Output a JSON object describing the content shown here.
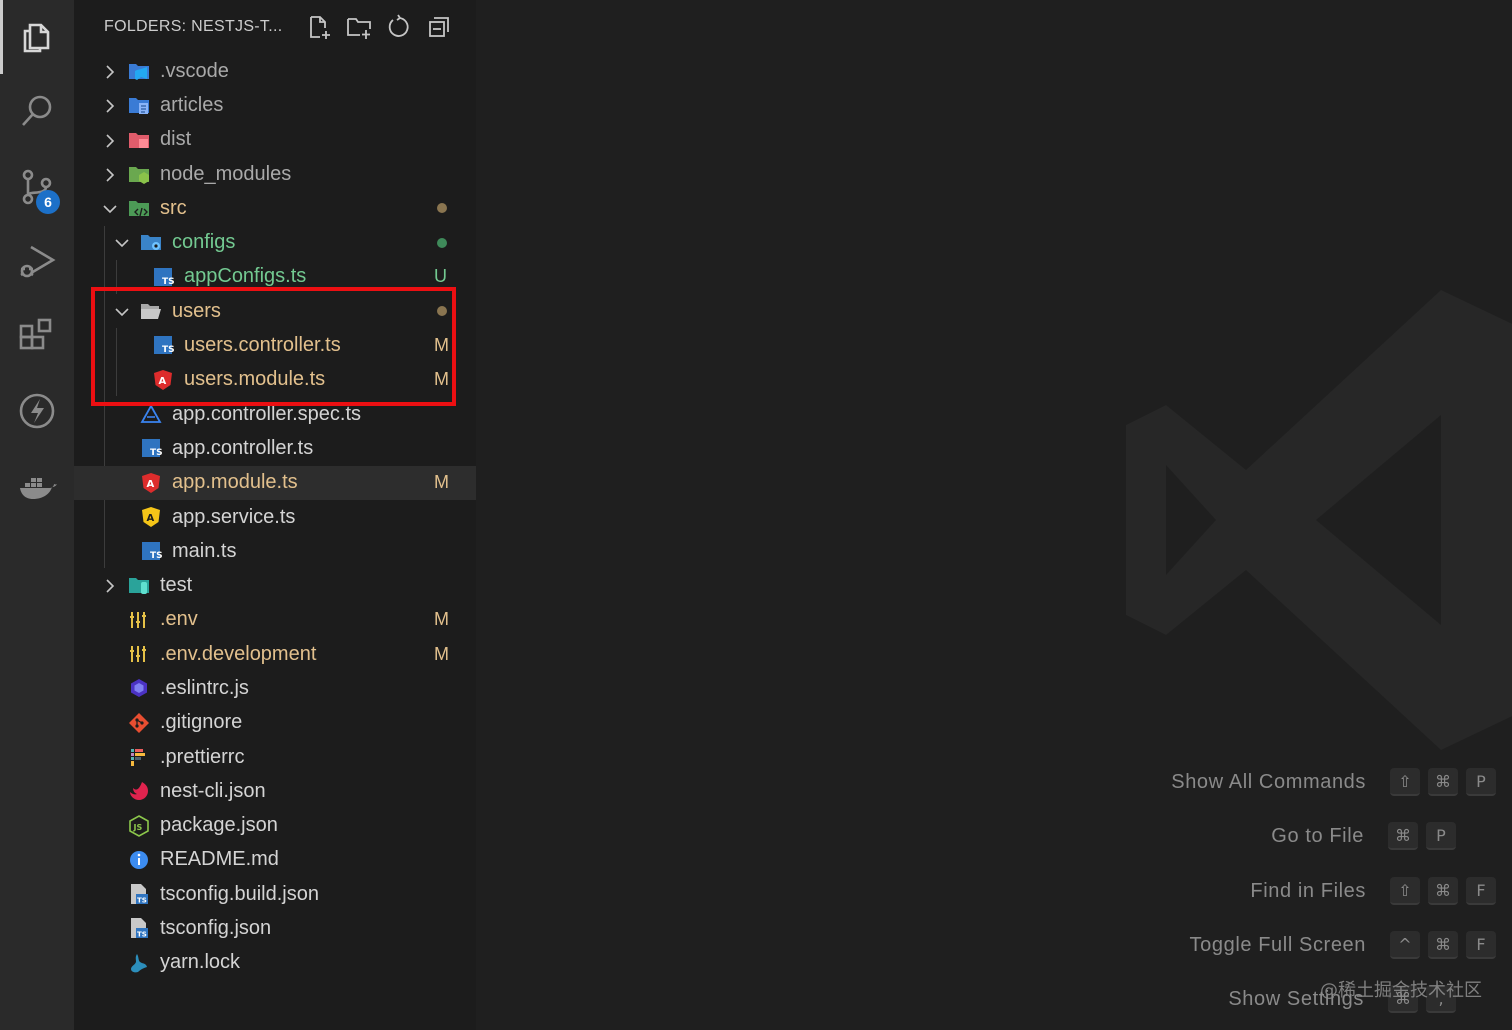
{
  "explorer": {
    "title": "FOLDERS: NESTJS-T...",
    "actions": [
      "new-file-icon",
      "new-folder-icon",
      "refresh-icon",
      "collapse-all-icon"
    ]
  },
  "activity_bar": {
    "items": [
      "explorer-icon",
      "search-icon",
      "source-control-icon",
      "run-debug-icon",
      "extensions-icon",
      "thunder-client-icon",
      "docker-icon"
    ],
    "source_control_badge": "6"
  },
  "tree": [
    {
      "name": ".vscode",
      "type": "folder",
      "expanded": false,
      "depth": 0,
      "icon": "vscode-folder-icon",
      "status": "",
      "color": "dim"
    },
    {
      "name": "articles",
      "type": "folder",
      "expanded": false,
      "depth": 0,
      "icon": "articles-folder-icon",
      "status": "",
      "color": "dim"
    },
    {
      "name": "dist",
      "type": "folder",
      "expanded": false,
      "depth": 0,
      "icon": "dist-folder-icon",
      "status": "",
      "color": "dim"
    },
    {
      "name": "node_modules",
      "type": "folder",
      "expanded": false,
      "depth": 0,
      "icon": "node-modules-folder-icon",
      "status": "",
      "color": "dim"
    },
    {
      "name": "src",
      "type": "folder",
      "expanded": true,
      "depth": 0,
      "icon": "src-folder-icon",
      "status": "dot",
      "color": "mod"
    },
    {
      "name": "configs",
      "type": "folder",
      "expanded": true,
      "depth": 1,
      "icon": "configs-folder-icon",
      "status": "dot-green",
      "color": "untracked"
    },
    {
      "name": "appConfigs.ts",
      "type": "file",
      "depth": 2,
      "icon": "typescript-icon",
      "status": "U",
      "color": "untracked"
    },
    {
      "name": "users",
      "type": "folder",
      "expanded": true,
      "depth": 1,
      "icon": "folder-open-icon",
      "status": "dot",
      "color": "mod"
    },
    {
      "name": "users.controller.ts",
      "type": "file",
      "depth": 2,
      "icon": "typescript-icon",
      "status": "M",
      "color": "mod"
    },
    {
      "name": "users.module.ts",
      "type": "file",
      "depth": 2,
      "icon": "angular-red-icon",
      "status": "M",
      "color": "mod"
    },
    {
      "name": "app.controller.spec.ts",
      "type": "file",
      "depth": 1,
      "icon": "angular-test-icon",
      "status": "",
      "color": "white"
    },
    {
      "name": "app.controller.ts",
      "type": "file",
      "depth": 1,
      "icon": "typescript-icon",
      "status": "",
      "color": "white"
    },
    {
      "name": "app.module.ts",
      "type": "file",
      "depth": 1,
      "icon": "angular-red-icon",
      "status": "M",
      "color": "mod",
      "selected": true
    },
    {
      "name": "app.service.ts",
      "type": "file",
      "depth": 1,
      "icon": "angular-yellow-icon",
      "status": "",
      "color": "white"
    },
    {
      "name": "main.ts",
      "type": "file",
      "depth": 1,
      "icon": "typescript-icon",
      "status": "",
      "color": "white"
    },
    {
      "name": "test",
      "type": "folder",
      "expanded": false,
      "depth": 0,
      "icon": "test-folder-icon",
      "status": "",
      "color": "white"
    },
    {
      "name": ".env",
      "type": "file",
      "depth": 0,
      "icon": "env-icon",
      "status": "M",
      "color": "mod"
    },
    {
      "name": ".env.development",
      "type": "file",
      "depth": 0,
      "icon": "env-icon",
      "status": "M",
      "color": "mod"
    },
    {
      "name": ".eslintrc.js",
      "type": "file",
      "depth": 0,
      "icon": "eslint-icon",
      "status": "",
      "color": "white"
    },
    {
      "name": ".gitignore",
      "type": "file",
      "depth": 0,
      "icon": "git-icon",
      "status": "",
      "color": "white"
    },
    {
      "name": ".prettierrc",
      "type": "file",
      "depth": 0,
      "icon": "prettier-icon",
      "status": "",
      "color": "white"
    },
    {
      "name": "nest-cli.json",
      "type": "file",
      "depth": 0,
      "icon": "nest-icon",
      "status": "",
      "color": "white"
    },
    {
      "name": "package.json",
      "type": "file",
      "depth": 0,
      "icon": "nodejs-icon",
      "status": "",
      "color": "white"
    },
    {
      "name": "README.md",
      "type": "file",
      "depth": 0,
      "icon": "info-icon",
      "status": "",
      "color": "white"
    },
    {
      "name": "tsconfig.build.json",
      "type": "file",
      "depth": 0,
      "icon": "tsconfig-icon",
      "status": "",
      "color": "white"
    },
    {
      "name": "tsconfig.json",
      "type": "file",
      "depth": 0,
      "icon": "tsconfig-icon",
      "status": "",
      "color": "white"
    },
    {
      "name": "yarn.lock",
      "type": "file",
      "depth": 0,
      "icon": "yarn-icon",
      "status": "",
      "color": "white"
    }
  ],
  "shortcuts": [
    {
      "label": "Show All Commands",
      "keys": [
        "⇧",
        "⌘",
        "P"
      ]
    },
    {
      "label": "Go to File",
      "keys": [
        "⌘",
        "P"
      ]
    },
    {
      "label": "Find in Files",
      "keys": [
        "⇧",
        "⌘",
        "F"
      ]
    },
    {
      "label": "Toggle Full Screen",
      "keys": [
        "^",
        "⌘",
        "F"
      ]
    },
    {
      "label": "Show Settings",
      "keys": [
        "⌘",
        ","
      ]
    }
  ],
  "watermark_text": "@稀土掘金技术社区",
  "colors": {
    "activity_bg": "#2a2a2a",
    "sidebar_bg": "#1c1c1c",
    "editor_bg": "#1f1f1f",
    "modified": "#e2c08d",
    "untracked": "#73c991",
    "highlight_box": "#ec0f12",
    "badge": "#1c70c8"
  }
}
